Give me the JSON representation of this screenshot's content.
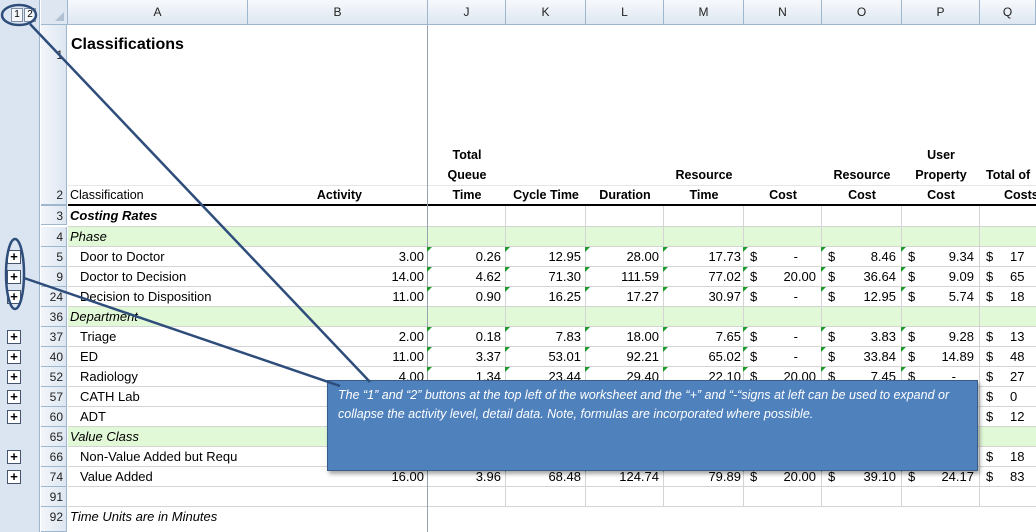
{
  "outline": {
    "levels": [
      "1",
      "2"
    ]
  },
  "columns": [
    "A",
    "B",
    "J",
    "K",
    "L",
    "M",
    "N",
    "O",
    "P",
    "Q"
  ],
  "title": "Classifications",
  "header_row": {
    "num": "2",
    "classification": "Classification",
    "activity": "Activity",
    "j": [
      "Total",
      "Queue",
      "Time"
    ],
    "k": [
      "Cycle Time"
    ],
    "l": [
      "Duration"
    ],
    "m": [
      "Resource",
      "Time"
    ],
    "n": [
      "Cost"
    ],
    "o": [
      "Resource",
      "Cost"
    ],
    "p": [
      "User",
      "Property",
      "Cost"
    ],
    "q": [
      "Total of",
      "Costs"
    ]
  },
  "row_numbers": [
    "1",
    "2",
    "3",
    "4",
    "5",
    "9",
    "24",
    "36",
    "37",
    "40",
    "52",
    "57",
    "60",
    "65",
    "66",
    "74",
    "91",
    "92"
  ],
  "section_labels": {
    "costing_rates": "Costing Rates",
    "phase": "Phase",
    "department": "Department",
    "value_class": "Value Class",
    "footer": "Time Units are in Minutes"
  },
  "rows": [
    {
      "label": "Door to Doctor",
      "b": "3.00",
      "j": "0.26",
      "k": "12.95",
      "l": "28.00",
      "m": "17.73",
      "n": "-",
      "o": "8.46",
      "p": "9.34",
      "q": "17"
    },
    {
      "label": "Doctor to Decision",
      "b": "14.00",
      "j": "4.62",
      "k": "71.30",
      "l": "111.59",
      "m": "77.02",
      "n": "20.00",
      "o": "36.64",
      "p": "9.09",
      "q": "65"
    },
    {
      "label": "Decision to Disposition",
      "b": "11.00",
      "j": "0.90",
      "k": "16.25",
      "l": "17.27",
      "m": "30.97",
      "n": "-",
      "o": "12.95",
      "p": "5.74",
      "q": "18"
    },
    {
      "label": "Triage",
      "b": "2.00",
      "j": "0.18",
      "k": "7.83",
      "l": "18.00",
      "m": "7.65",
      "n": "-",
      "o": "3.83",
      "p": "9.28",
      "q": "13"
    },
    {
      "label": "ED",
      "b": "11.00",
      "j": "3.37",
      "k": "53.01",
      "l": "92.21",
      "m": "65.02",
      "n": "-",
      "o": "33.84",
      "p": "14.89",
      "q": "48"
    },
    {
      "label": "Radiology",
      "b": "4.00",
      "j": "1.34",
      "k": "23.44",
      "l": "29.40",
      "m": "22.10",
      "n": "20.00",
      "o": "7.45",
      "p": "-",
      "q": "27"
    },
    {
      "label": "CATH Lab",
      "b": "",
      "j": "",
      "k": "",
      "l": "",
      "m": "",
      "n": "",
      "o": "",
      "p": "",
      "q": "0"
    },
    {
      "label": "ADT",
      "b": "",
      "j": "",
      "k": "",
      "l": "",
      "m": "",
      "n": "",
      "o": "",
      "p": "",
      "q": "12"
    },
    {
      "label": "Non-Value Added but Requ",
      "b": "7.00",
      "j": "1.82",
      "k": "32.03",
      "l": "32.12",
      "m": "45.83",
      "n": "-",
      "o": "18.97",
      "p": "-",
      "q": "18"
    },
    {
      "label": "Value Added",
      "b": "16.00",
      "j": "3.96",
      "k": "68.48",
      "l": "124.74",
      "m": "79.89",
      "n": "20.00",
      "o": "39.10",
      "p": "24.17",
      "q": "83"
    }
  ],
  "currency_symbol": "$",
  "callout": "The “1” and “2” buttons at the top left of the worksheet and the “+” and “-“signs at left can be used to expand or collapse the activity level, detail data.  Note, formulas are incorporated where possible.",
  "expand_symbol": "+"
}
